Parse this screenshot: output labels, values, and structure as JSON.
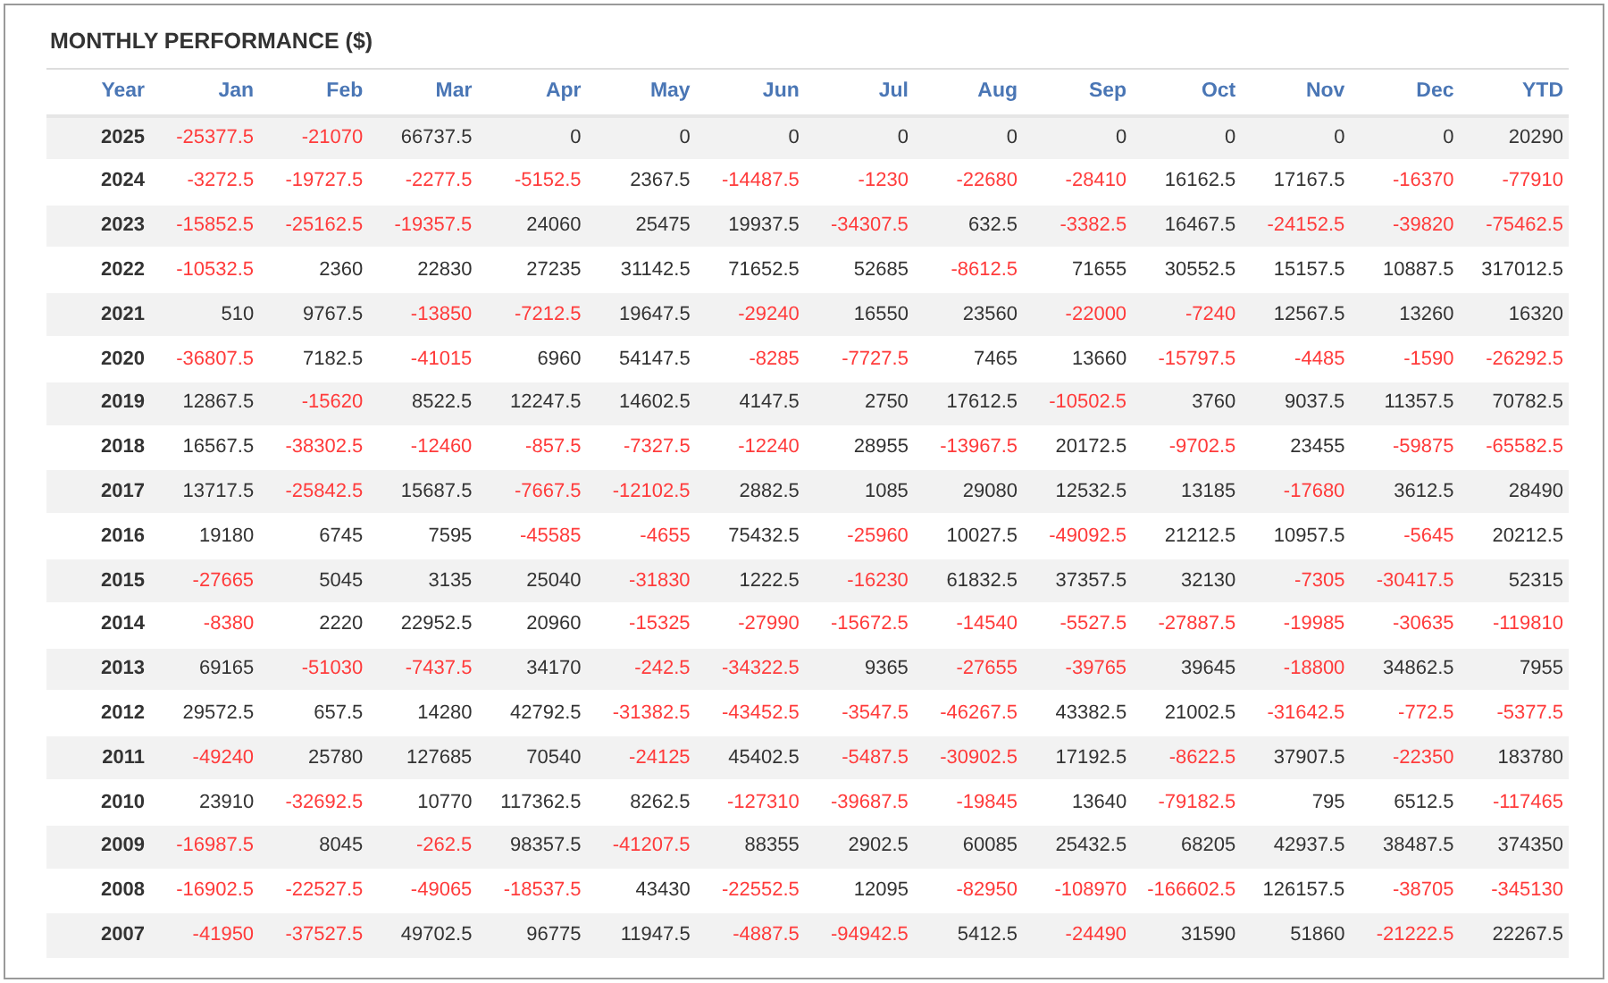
{
  "title": "MONTHLY PERFORMANCE ($)",
  "table": {
    "columns": [
      "Year",
      "Jan",
      "Feb",
      "Mar",
      "Apr",
      "May",
      "Jun",
      "Jul",
      "Aug",
      "Sep",
      "Oct",
      "Nov",
      "Dec",
      "YTD"
    ],
    "rows": [
      {
        "cells": [
          "2025",
          "-25377.5",
          "-21070",
          "66737.5",
          "0",
          "0",
          "0",
          "0",
          "0",
          "0",
          "0",
          "0",
          "0",
          "20290"
        ]
      },
      {
        "cells": [
          "2024",
          "-3272.5",
          "-19727.5",
          "-2277.5",
          "-5152.5",
          "2367.5",
          "-14487.5",
          "-1230",
          "-22680",
          "-28410",
          "16162.5",
          "17167.5",
          "-16370",
          "-77910"
        ]
      },
      {
        "cells": [
          "2023",
          "-15852.5",
          "-25162.5",
          "-19357.5",
          "24060",
          "25475",
          "19937.5",
          "-34307.5",
          "632.5",
          "-3382.5",
          "16467.5",
          "-24152.5",
          "-39820",
          "-75462.5"
        ]
      },
      {
        "cells": [
          "2022",
          "-10532.5",
          "2360",
          "22830",
          "27235",
          "31142.5",
          "71652.5",
          "52685",
          "-8612.5",
          "71655",
          "30552.5",
          "15157.5",
          "10887.5",
          "317012.5"
        ]
      },
      {
        "cells": [
          "2021",
          "510",
          "9767.5",
          "-13850",
          "-7212.5",
          "19647.5",
          "-29240",
          "16550",
          "23560",
          "-22000",
          "-7240",
          "12567.5",
          "13260",
          "16320"
        ]
      },
      {
        "cells": [
          "2020",
          "-36807.5",
          "7182.5",
          "-41015",
          "6960",
          "54147.5",
          "-8285",
          "-7727.5",
          "7465",
          "13660",
          "-15797.5",
          "-4485",
          "-1590",
          "-26292.5"
        ]
      },
      {
        "cells": [
          "2019",
          "12867.5",
          "-15620",
          "8522.5",
          "12247.5",
          "14602.5",
          "4147.5",
          "2750",
          "17612.5",
          "-10502.5",
          "3760",
          "9037.5",
          "11357.5",
          "70782.5"
        ]
      },
      {
        "cells": [
          "2018",
          "16567.5",
          "-38302.5",
          "-12460",
          "-857.5",
          "-7327.5",
          "-12240",
          "28955",
          "-13967.5",
          "20172.5",
          "-9702.5",
          "23455",
          "-59875",
          "-65582.5"
        ]
      },
      {
        "cells": [
          "2017",
          "13717.5",
          "-25842.5",
          "15687.5",
          "-7667.5",
          "-12102.5",
          "2882.5",
          "1085",
          "29080",
          "12532.5",
          "13185",
          "-17680",
          "3612.5",
          "28490"
        ]
      },
      {
        "cells": [
          "2016",
          "19180",
          "6745",
          "7595",
          "-45585",
          "-4655",
          "75432.5",
          "-25960",
          "10027.5",
          "-49092.5",
          "21212.5",
          "10957.5",
          "-5645",
          "20212.5"
        ]
      },
      {
        "cells": [
          "2015",
          "-27665",
          "5045",
          "3135",
          "25040",
          "-31830",
          "1222.5",
          "-16230",
          "61832.5",
          "37357.5",
          "32130",
          "-7305",
          "-30417.5",
          "52315"
        ]
      },
      {
        "cells": [
          "2014",
          "-8380",
          "2220",
          "22952.5",
          "20960",
          "-15325",
          "-27990",
          "-15672.5",
          "-14540",
          "-5527.5",
          "-27887.5",
          "-19985",
          "-30635",
          "-119810"
        ]
      },
      {
        "cells": [
          "2013",
          "69165",
          "-51030",
          "-7437.5",
          "34170",
          "-242.5",
          "-34322.5",
          "9365",
          "-27655",
          "-39765",
          "39645",
          "-18800",
          "34862.5",
          "7955"
        ]
      },
      {
        "cells": [
          "2012",
          "29572.5",
          "657.5",
          "14280",
          "42792.5",
          "-31382.5",
          "-43452.5",
          "-3547.5",
          "-46267.5",
          "43382.5",
          "21002.5",
          "-31642.5",
          "-772.5",
          "-5377.5"
        ]
      },
      {
        "cells": [
          "2011",
          "-49240",
          "25780",
          "127685",
          "70540",
          "-24125",
          "45402.5",
          "-5487.5",
          "-30902.5",
          "17192.5",
          "-8622.5",
          "37907.5",
          "-22350",
          "183780"
        ]
      },
      {
        "cells": [
          "2010",
          "23910",
          "-32692.5",
          "10770",
          "117362.5",
          "8262.5",
          "-127310",
          "-39687.5",
          "-19845",
          "13640",
          "-79182.5",
          "795",
          "6512.5",
          "-117465"
        ]
      },
      {
        "cells": [
          "2009",
          "-16987.5",
          "8045",
          "-262.5",
          "98357.5",
          "-41207.5",
          "88355",
          "2902.5",
          "60085",
          "25432.5",
          "68205",
          "42937.5",
          "38487.5",
          "374350"
        ]
      },
      {
        "cells": [
          "2008",
          "-16902.5",
          "-22527.5",
          "-49065",
          "-18537.5",
          "43430",
          "-22552.5",
          "12095",
          "-82950",
          "-108970",
          "-166602.5",
          "126157.5",
          "-38705",
          "-345130"
        ]
      },
      {
        "cells": [
          "2007",
          "-41950",
          "-37527.5",
          "49702.5",
          "96775",
          "11947.5",
          "-4887.5",
          "-94942.5",
          "5412.5",
          "-24490",
          "31590",
          "51860",
          "-21222.5",
          "22267.5"
        ]
      }
    ]
  }
}
